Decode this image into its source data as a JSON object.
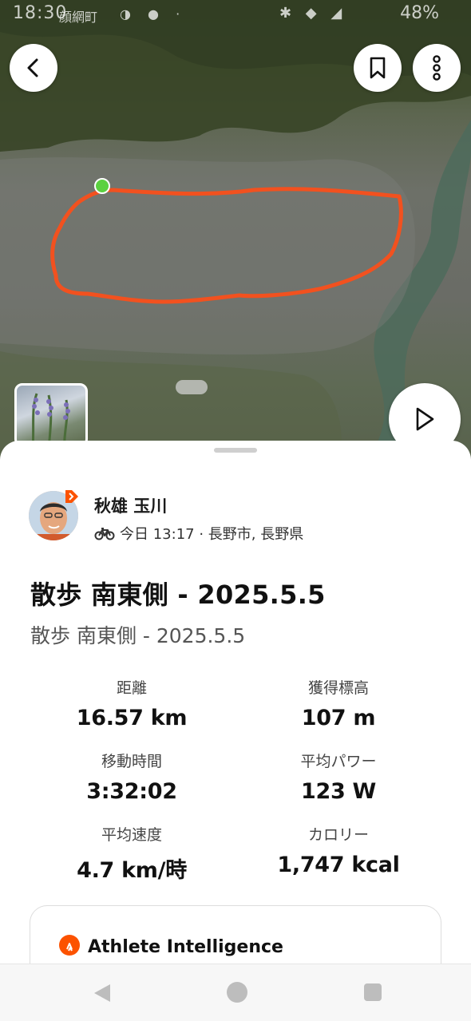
{
  "status_bar": {
    "time": "18:30",
    "carrier": "顔網町",
    "battery": "48%"
  },
  "map": {
    "route_color": "#f2511f",
    "start_color": "#5bd140",
    "icons": {
      "back": "chevron-left-icon",
      "bookmark": "bookmark-icon",
      "more": "more-vertical-icon",
      "play": "play-icon"
    }
  },
  "athlete": {
    "name": "秋雄 玉川",
    "sport_icon": "bike-icon",
    "meta": "今日 13:17 · 長野市, 長野県"
  },
  "activity": {
    "title": "散歩 南東側 - 2025.5.5",
    "description": "散歩 南東側 - 2025.5.5"
  },
  "stats": [
    {
      "label": "距離",
      "value": "16.57 km"
    },
    {
      "label": "獲得標高",
      "value": "107 m"
    },
    {
      "label": "移動時間",
      "value": "3:32:02"
    },
    {
      "label": "平均パワー",
      "value": "123 W"
    },
    {
      "label": "平均速度",
      "value": "4.7 km/時"
    },
    {
      "label": "カロリー",
      "value": "1,747 kcal"
    }
  ],
  "athlete_intelligence": {
    "title": "Athlete Intelligence",
    "accent": "#fc5200"
  },
  "navbar": {
    "icons": [
      "nav-back-icon",
      "nav-home-icon",
      "nav-recents-icon"
    ]
  }
}
